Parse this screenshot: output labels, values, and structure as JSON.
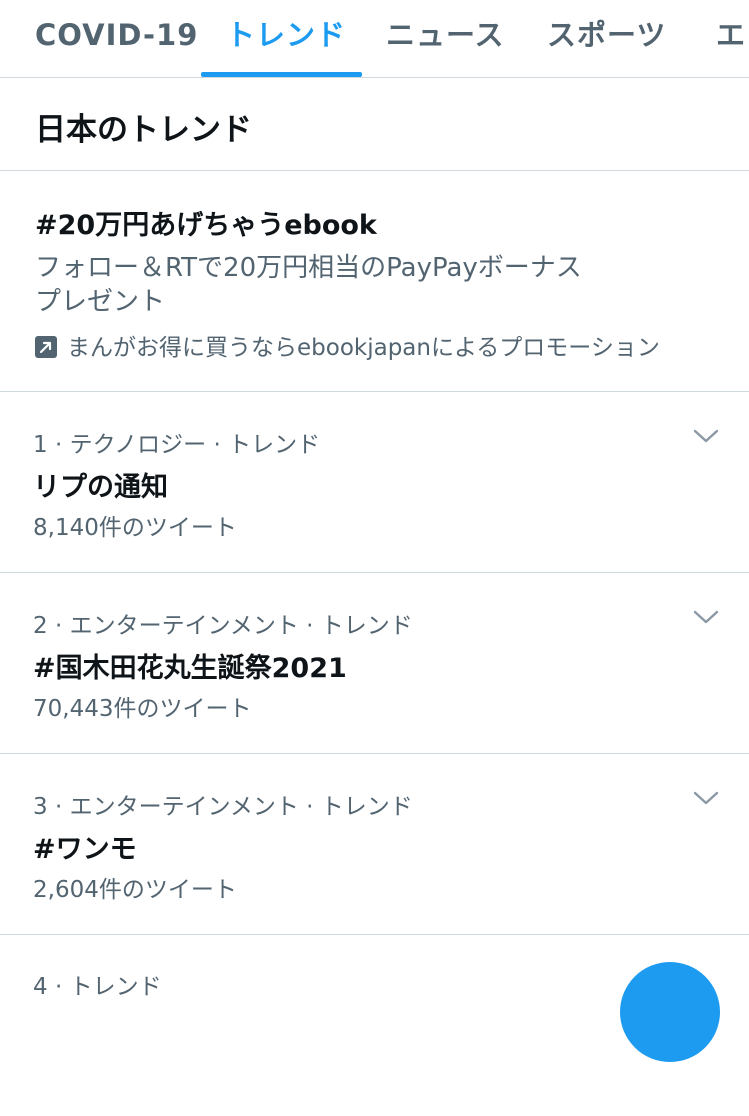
{
  "tabs": [
    {
      "label": "COVID-19"
    },
    {
      "label": "トレンド"
    },
    {
      "label": "ニュース"
    },
    {
      "label": "スポーツ"
    },
    {
      "label": "エ"
    }
  ],
  "section": {
    "title": "日本のトレンド"
  },
  "promo": {
    "title": "#20万円あげちゃうebook",
    "description_line1": "フォロー＆RTで20万円相当のPayPayボーナス",
    "description_line2": "プレゼント",
    "promoted_by": "まんがお得に買うならebookjapanによるプロモーション",
    "icon": "promoted-arrow-icon"
  },
  "trends": [
    {
      "meta": "1 · テクノロジー · トレンド",
      "name": "リプの通知",
      "count": "8,140件のツイート"
    },
    {
      "meta": "2 · エンターテインメント · トレンド",
      "name": "#国木田花丸生誕祭2021",
      "count": "70,443件のツイート"
    },
    {
      "meta": "3 · エンターテインメント · トレンド",
      "name": "#ワンモ",
      "count": "2,604件のツイート"
    },
    {
      "meta": "4 · トレンド",
      "name": "",
      "count": ""
    }
  ],
  "colors": {
    "accent": "#1d9bf0",
    "secondary_text": "#536471",
    "divider": "#cfd9de"
  }
}
